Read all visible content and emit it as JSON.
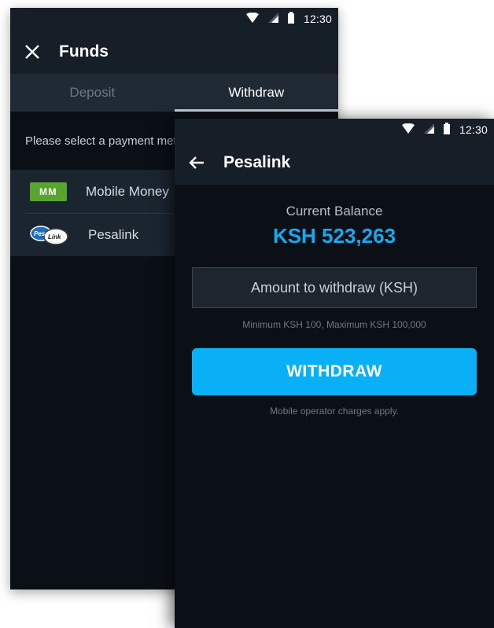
{
  "back_screen": {
    "status_bar": {
      "time": "12:30"
    },
    "app_bar": {
      "title": "Funds"
    },
    "tabs": [
      {
        "label": "Deposit",
        "active": false
      },
      {
        "label": "Withdraw",
        "active": true
      }
    ],
    "hint": "Please select a payment method",
    "methods": [
      {
        "label": "Mobile Money",
        "logo_text": "MM",
        "icon": "mobile-money-logo"
      },
      {
        "label": "Pesalink",
        "logo_text": "PesaLink",
        "icon": "pesalink-logo"
      }
    ]
  },
  "front_screen": {
    "status_bar": {
      "time": "12:30"
    },
    "app_bar": {
      "title": "Pesalink"
    },
    "balance_label": "Current Balance",
    "balance_value": "KSH 523,263",
    "amount_placeholder": "Amount to withdraw (KSH)",
    "limits_text": "Minimum KSH 100, Maximum KSH 100,000",
    "withdraw_label": "WITHDRAW",
    "charges_text": "Mobile operator charges apply."
  },
  "colors": {
    "background": "#0b1016",
    "bar": "#161e27",
    "accent": "#0ab0f6",
    "balance": "#19a7f0",
    "mobile_money_green": "#59a42e"
  }
}
